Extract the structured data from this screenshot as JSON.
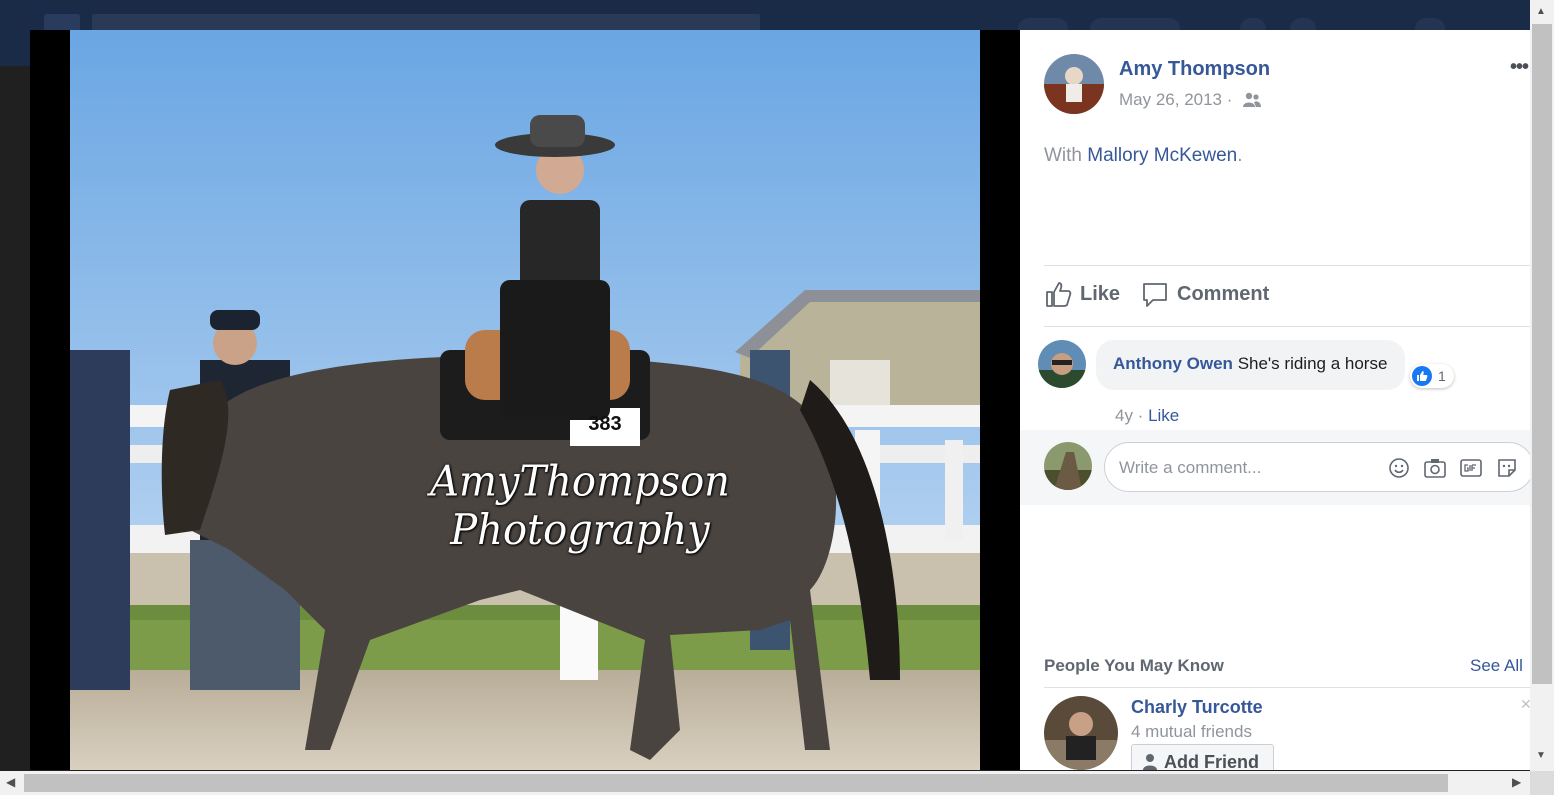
{
  "post": {
    "author": "Amy Thompson",
    "date": "May 26, 2013 ·",
    "privacy_icon": "friends-icon",
    "more_label": "•••",
    "with_prefix": "With ",
    "with_name": "Mallory McKewen",
    "with_suffix": "."
  },
  "photo": {
    "watermark": "AmyThompson Photography",
    "bib_number": "383"
  },
  "actions": {
    "like": "Like",
    "comment": "Comment"
  },
  "comments": [
    {
      "author": "Anthony Owen",
      "text": "She's riding a horse",
      "reaction_count": "1",
      "age": "4y ·",
      "like": "Like"
    }
  ],
  "composer": {
    "placeholder": "Write a comment..."
  },
  "pymk": {
    "title": "People You May Know",
    "see_all": "See All",
    "people": [
      {
        "name": "Charly Turcotte",
        "mutual": "4 mutual friends",
        "button": "Add Friend"
      }
    ]
  },
  "colors": {
    "link": "#365899",
    "muted": "#90949c",
    "like_blue": "#1877f2"
  }
}
